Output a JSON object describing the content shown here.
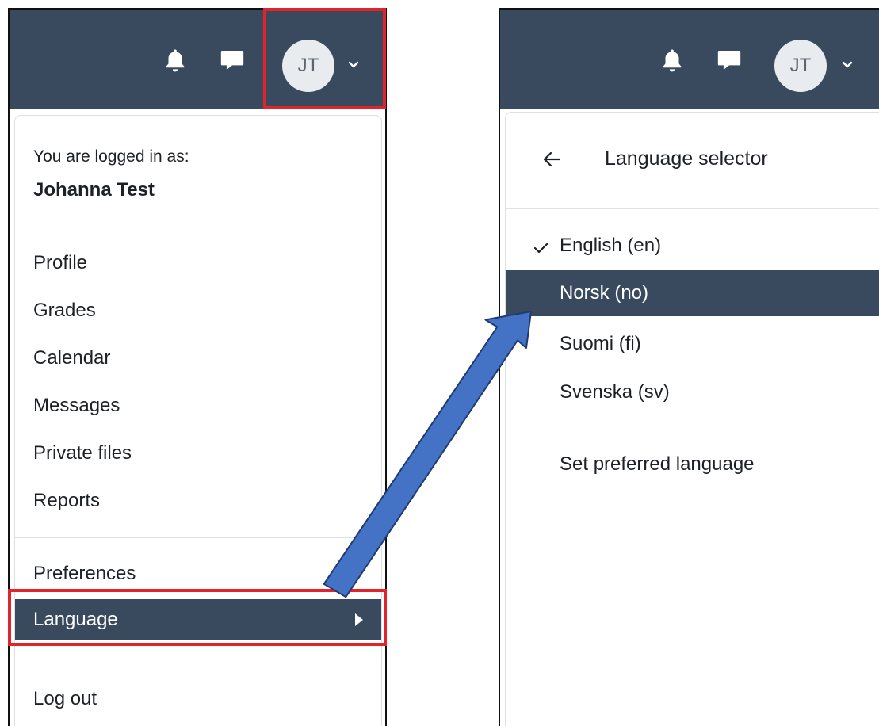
{
  "user_menu": {
    "avatar_initials": "JT",
    "logged_in_label": "You are logged in as:",
    "user_name": "Johanna Test",
    "items": [
      "Profile",
      "Grades",
      "Calendar",
      "Messages",
      "Private files",
      "Reports"
    ],
    "preferences_label": "Preferences",
    "language_label": "Language",
    "logout_label": "Log out"
  },
  "language_selector": {
    "title": "Language selector",
    "languages": [
      "English (en)",
      "Norsk (no)",
      "Suomi (fi)",
      "Svenska (sv)"
    ],
    "selected_language": "English (en)",
    "highlighted_language": "Norsk (no)",
    "set_preferred_label": "Set preferred language"
  },
  "colors": {
    "navbar": "#3a4a5e",
    "highlight": "#3a4a5e",
    "annotation_red": "#e3232a",
    "arrow_blue": "#4472c4"
  },
  "icons": [
    "bell-icon",
    "chat-icon",
    "chevron-down-icon",
    "caret-right-icon",
    "arrow-left-icon",
    "check-icon"
  ]
}
